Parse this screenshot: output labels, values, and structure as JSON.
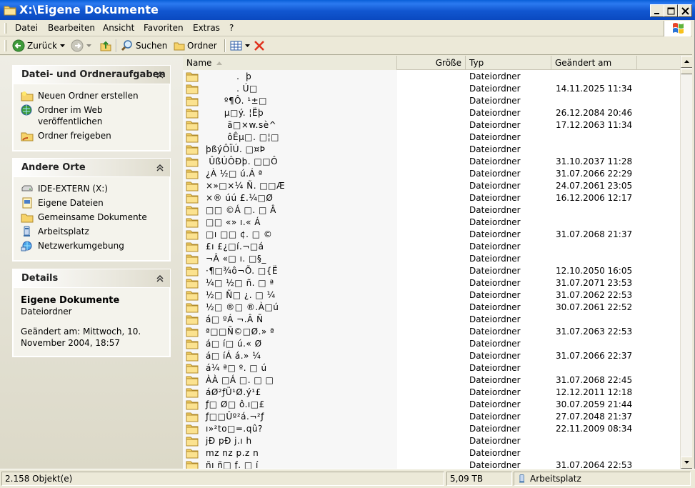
{
  "window": {
    "title": "X:\\Eigene Dokumente"
  },
  "menu": [
    "Datei",
    "Bearbeiten",
    "Ansicht",
    "Favoriten",
    "Extras",
    "?"
  ],
  "toolbar": {
    "back_label": "Zurück",
    "search_label": "Suchen",
    "folders_label": "Ordner"
  },
  "tasks_panel": {
    "title": "Datei- und Ordneraufgaben",
    "items": [
      "Neuen Ordner erstellen",
      "Ordner im Web veröffentlichen",
      "Ordner freigeben"
    ]
  },
  "places_panel": {
    "title": "Andere Orte",
    "items": [
      "IDE-EXTERN (X:)",
      "Eigene Dateien",
      "Gemeinsame Dokumente",
      "Arbeitsplatz",
      "Netzwerkumgebung"
    ]
  },
  "details_panel": {
    "title": "Details",
    "name": "Eigene Dokumente",
    "type": "Dateiordner",
    "modified_line1": "Geändert am: Mittwoch, 10.",
    "modified_line2": "November 2004, 18:57"
  },
  "columns": {
    "name": "Name",
    "size": "Größe",
    "type": "Typ",
    "date": "Geändert am"
  },
  "files": [
    {
      "name": "          .  þ",
      "type": "Dateiordner",
      "date": ""
    },
    {
      "name": "          . Ú□",
      "type": "Dateiordner",
      "date": "14.11.2025 11:34"
    },
    {
      "name": "      º¶Ô. ¹±□",
      "type": "Dateiordner",
      "date": ""
    },
    {
      "name": "      µ□ý. ¦Ëþ",
      "type": "Dateiordner",
      "date": "26.12.2084 20:46"
    },
    {
      "name": "       ã□×w.sè^",
      "type": "Dateiordner",
      "date": "17.12.2063 11:34"
    },
    {
      "name": "       ôÊµ□. □¦□",
      "type": "Dateiordner",
      "date": ""
    },
    {
      "name": "þßýÔÏÚ. □¤Þ",
      "type": "Dateiordner",
      "date": ""
    },
    {
      "name": " ÛßÚÔÐþ. □□Ô",
      "type": "Dateiordner",
      "date": "31.10.2037 11:28"
    },
    {
      "name": "¿À ½□ ú.Á ª",
      "type": "Dateiordner",
      "date": "31.07.2066 22:29"
    },
    {
      "name": "×»□×¼ Ñ. □□Æ",
      "type": "Dateiordner",
      "date": "24.07.2061 23:05"
    },
    {
      "name": "×® úú £.¼□Ø",
      "type": "Dateiordner",
      "date": "16.12.2006 12:17"
    },
    {
      "name": "□□ ©Á □. □ Â",
      "type": "Dateiordner",
      "date": ""
    },
    {
      "name": "□□ «» ı.« Á",
      "type": "Dateiordner",
      "date": ""
    },
    {
      "name": "□ı □□ ¢. □ ©",
      "type": "Dateiordner",
      "date": "31.07.2068 21:37"
    },
    {
      "name": "£ı £¿□í.¬□á",
      "type": "Dateiordner",
      "date": ""
    },
    {
      "name": "¬Â «□ ı. □§_",
      "type": "Dateiordner",
      "date": ""
    },
    {
      "name": "·¶□¾ô¬Õ. □{Ë",
      "type": "Dateiordner",
      "date": "12.10.2050 16:05"
    },
    {
      "name": "¼□ ½□ ñ. □ ª",
      "type": "Dateiordner",
      "date": "31.07.2071 23:53"
    },
    {
      "name": "½□ Ñ□ ¿. □ ¼",
      "type": "Dateiordner",
      "date": "31.07.2062 22:53"
    },
    {
      "name": "½□ ®□ ®.À□ú",
      "type": "Dateiordner",
      "date": "30.07.2061 22:52"
    },
    {
      "name": "á□ ºÁ ¬.Â Ñ",
      "type": "Dateiordner",
      "date": ""
    },
    {
      "name": "ª□□Ñ©□Ø.» ª",
      "type": "Dateiordner",
      "date": "31.07.2063 22:53"
    },
    {
      "name": "á□ í□ ú.« Ø",
      "type": "Dateiordner",
      "date": ""
    },
    {
      "name": "á□ íÁ á.» ¼",
      "type": "Dateiordner",
      "date": "31.07.2066 22:37"
    },
    {
      "name": "á¼ ª□ º. □ ú",
      "type": "Dateiordner",
      "date": ""
    },
    {
      "name": "ÀÀ □Á □. □ □",
      "type": "Dateiordner",
      "date": "31.07.2068 22:45"
    },
    {
      "name": "áØ²ƒÜ¹Ø.ý¹£",
      "type": "Dateiordner",
      "date": "12.12.2011 12:18"
    },
    {
      "name": "ƒ□ Ø□ ô.ı□£",
      "type": "Dateiordner",
      "date": "30.07.2059 21:44"
    },
    {
      "name": "ƒ□□Ûº²á.¬²ƒ",
      "type": "Dateiordner",
      "date": "27.07.2048 21:37"
    },
    {
      "name": "ı»²to□=.qû?",
      "type": "Dateiordner",
      "date": "22.11.2009 08:34"
    },
    {
      "name": "jÐ pÐ j.ı h",
      "type": "Dateiordner",
      "date": ""
    },
    {
      "name": "mz nz p.z n",
      "type": "Dateiordner",
      "date": ""
    },
    {
      "name": "ñı ñ□ ƒ. □ í",
      "type": "Dateiordner",
      "date": "31.07.2064 22:53"
    }
  ],
  "status": {
    "count": "2.158 Objekt(e)",
    "size": "5,09 TB",
    "location": "Arbeitsplatz"
  }
}
